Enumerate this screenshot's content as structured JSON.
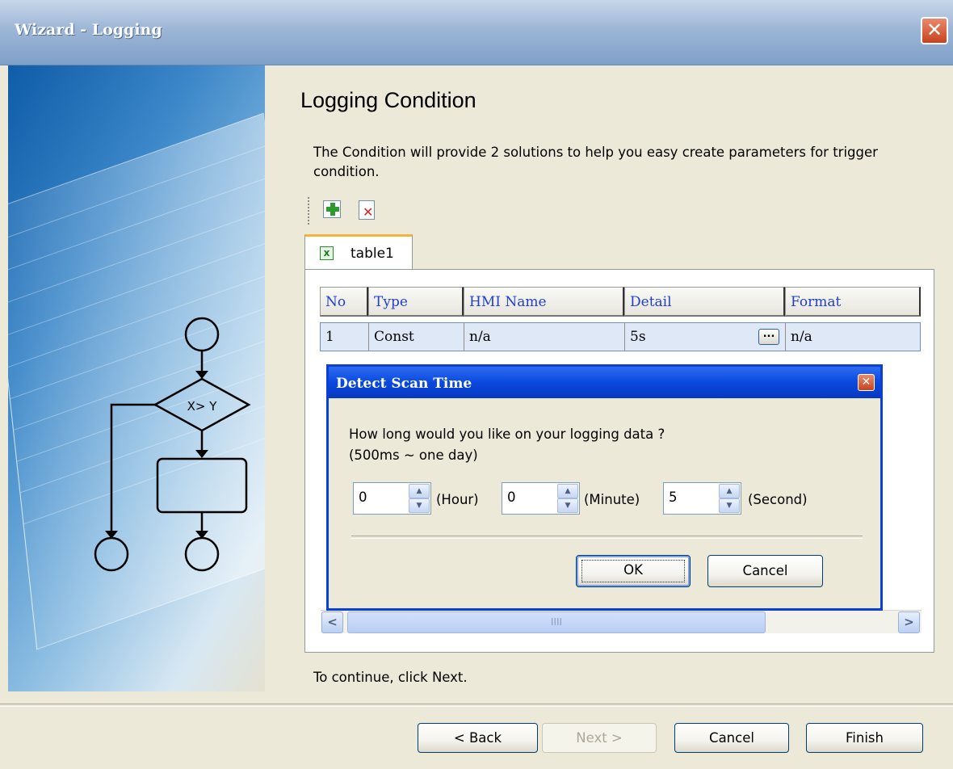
{
  "window": {
    "title": "Wizard - Logging",
    "close_glyph": "✕"
  },
  "page": {
    "heading": "Logging Condition",
    "description": "The Condition will provide 2 solutions to  help you easy create parameters for trigger condition.",
    "continue_hint": "To continue, click Next."
  },
  "toolbar": {
    "add_icon": "add-row-icon",
    "delete_icon": "delete-row-icon"
  },
  "tabs": [
    {
      "label": "table1",
      "icon": "excel-table-icon"
    }
  ],
  "table": {
    "columns": [
      "No",
      "Type",
      "HMI Name",
      "Detail",
      "Format"
    ],
    "rows": [
      {
        "no": "1",
        "type": "Const",
        "hmi_name": "n/a",
        "detail": "5s",
        "detail_button": "...",
        "format": "n/a"
      }
    ],
    "scroll_left": "<",
    "scroll_right": ">",
    "scroll_thumb_grip": "IIII"
  },
  "dialog": {
    "title": "Detect Scan Time",
    "close_glyph": "✕",
    "question": "How long would you like on your logging data ?",
    "range": "(500ms ~  one day)",
    "hour": {
      "value": "0",
      "unit": "(Hour)"
    },
    "minute": {
      "value": "0",
      "unit": "(Minute)"
    },
    "second": {
      "value": "5",
      "unit": "(Second)"
    },
    "ok_label": "OK",
    "cancel_label": "Cancel"
  },
  "footer": {
    "back_label": "< Back",
    "next_label": "Next >",
    "cancel_label": "Cancel",
    "finish_label": "Finish"
  },
  "decoration": {
    "flowchart_condition": "X> Y"
  },
  "colors": {
    "title_bar": "#9db6d6",
    "dialog_title_bar": "#0a49de",
    "header_text": "#1f3fd0",
    "selected_row": "#dfe8f7",
    "tab_accent": "#f5b43c"
  }
}
